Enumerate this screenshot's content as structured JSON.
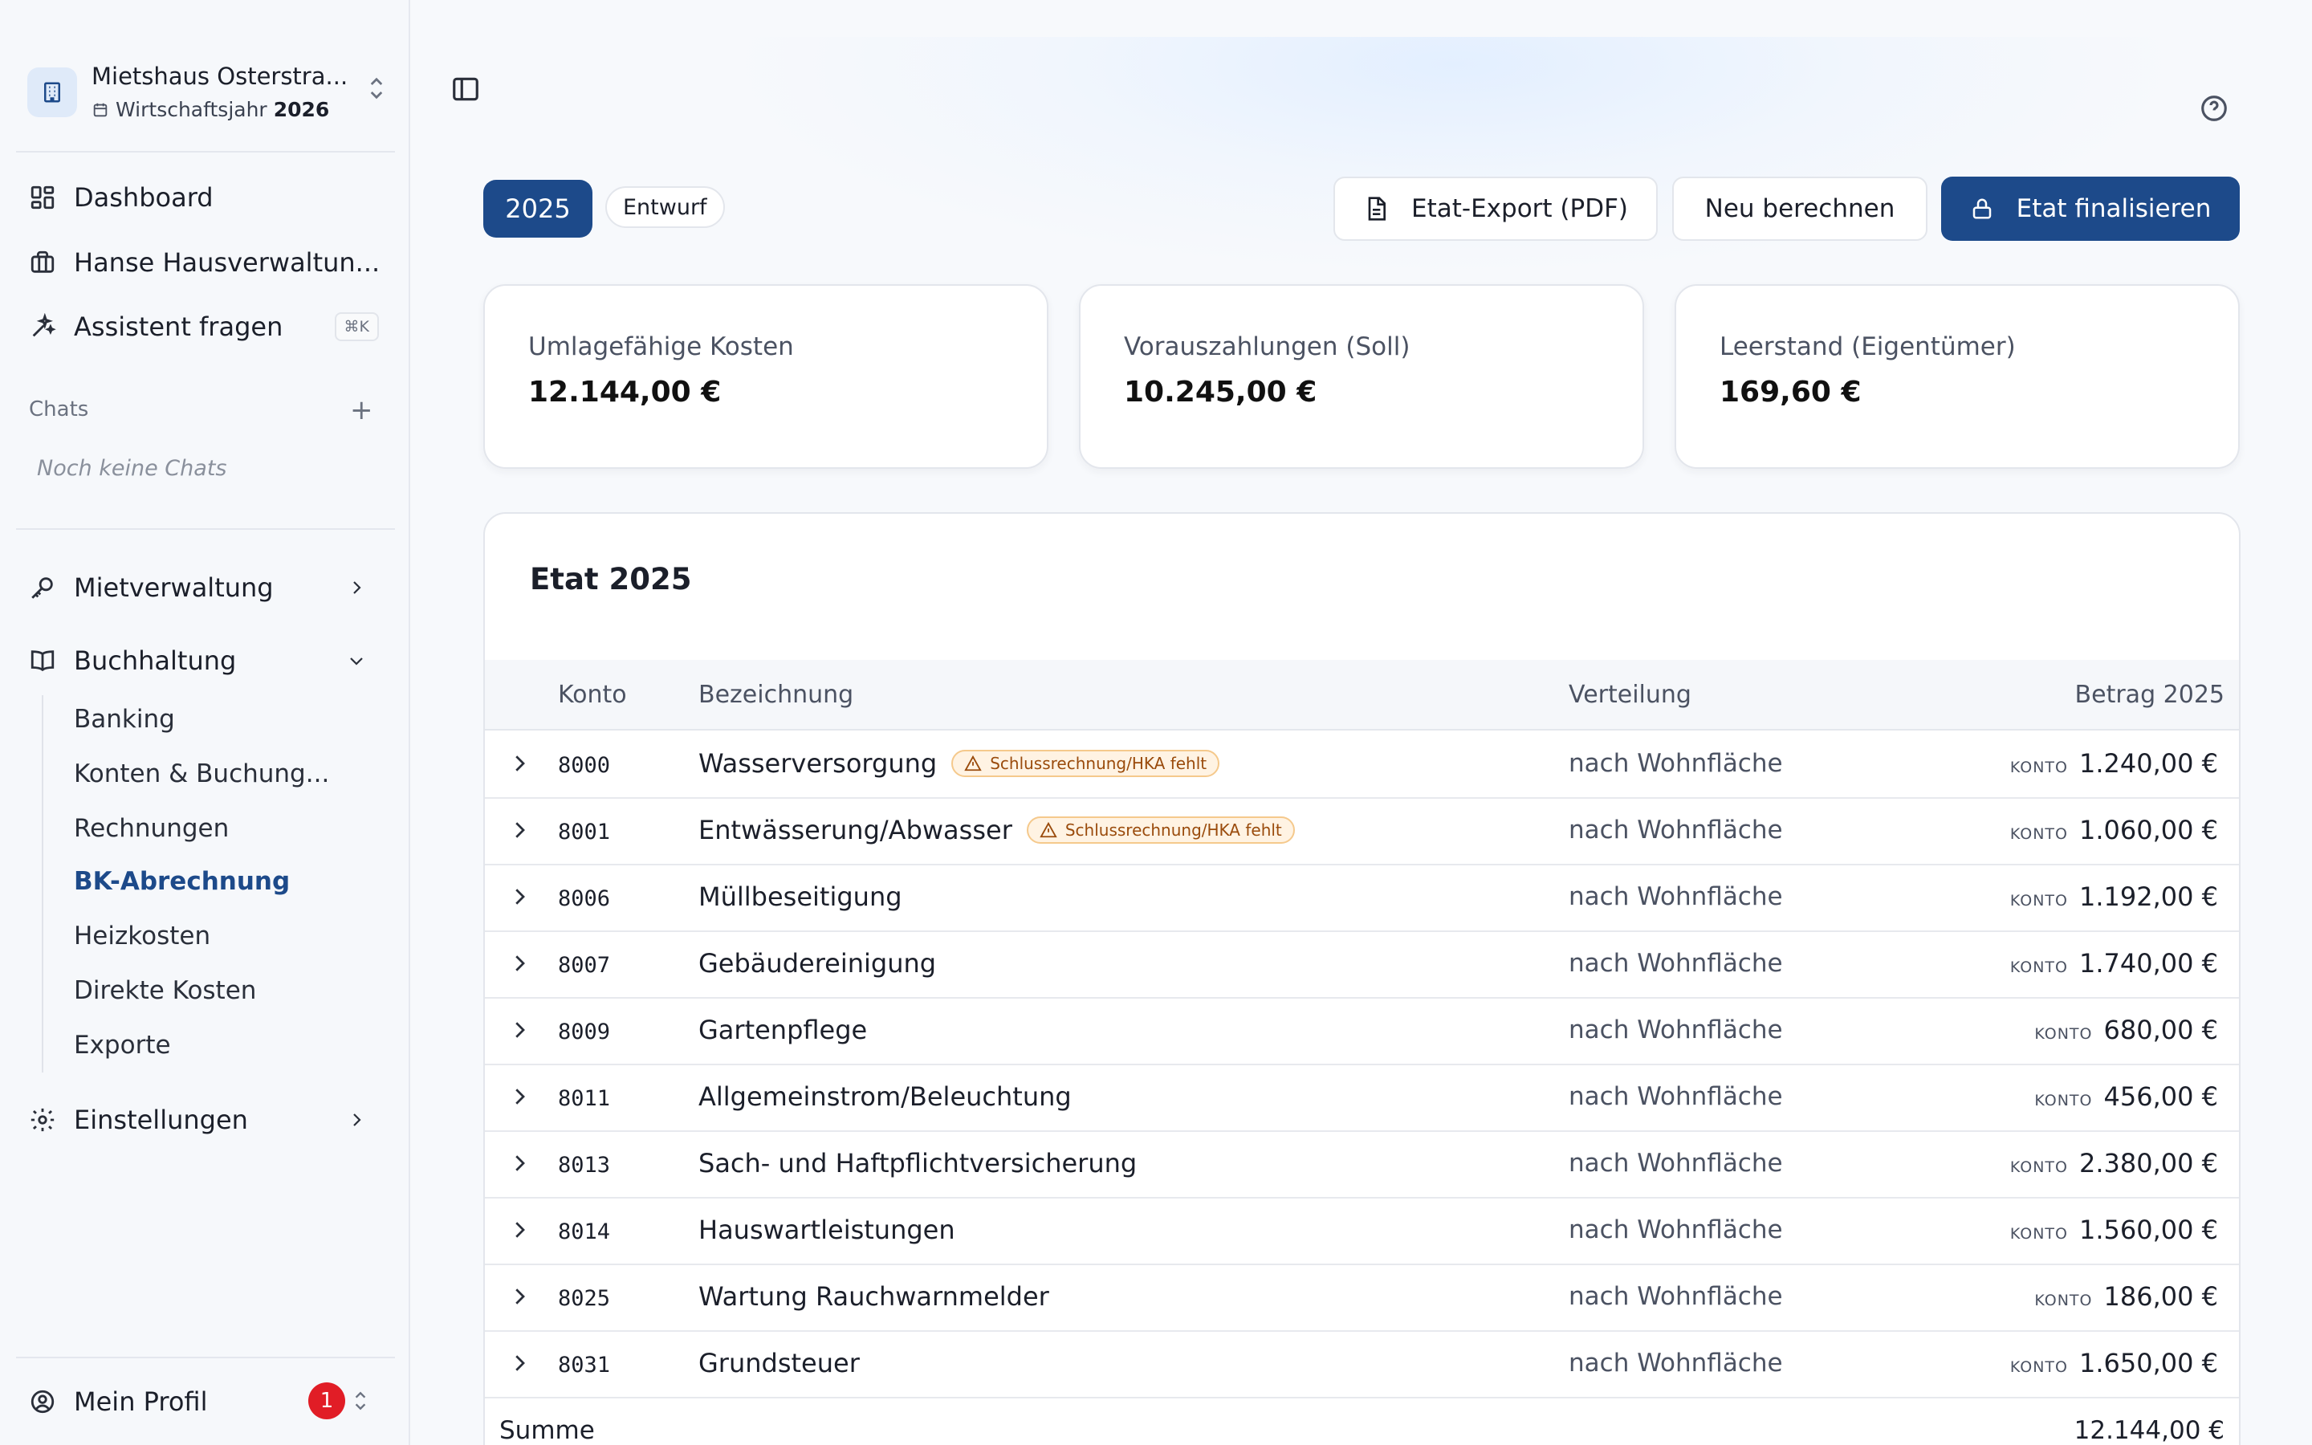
{
  "sidebar": {
    "property_name": "Mietshaus Osterstra...",
    "fiscal_year_label": "Wirtschaftsjahr",
    "fiscal_year": "2026",
    "nav": [
      {
        "label": "Dashboard",
        "icon": "dashboard-icon"
      },
      {
        "label": "Hanse Hausverwaltun...",
        "icon": "building-icon"
      },
      {
        "label": "Assistent fragen",
        "icon": "sparkles-icon",
        "shortcut": "⌘K"
      }
    ],
    "chats_label": "Chats",
    "chats_add": "+",
    "chats_empty": "Noch keine Chats",
    "sections": [
      {
        "label": "Mietverwaltung",
        "icon": "key-icon"
      },
      {
        "label": "Buchhaltung",
        "icon": "book-icon"
      }
    ],
    "buchhaltung_items": [
      "Banking",
      "Konten & Buchung...",
      "Rechnungen",
      "BK-Abrechnung",
      "Heizkosten",
      "Direkte Kosten",
      "Exporte"
    ],
    "active_item": "BK-Abrechnung",
    "settings_label": "Einstellungen",
    "profile_label": "Mein Profil",
    "profile_badge": "1"
  },
  "header": {
    "year": "2025",
    "status": "Entwurf",
    "export_btn": "Etat-Export (PDF)",
    "recalc_btn": "Neu berechnen",
    "finalize_btn": "Etat finalisieren"
  },
  "kpis": [
    {
      "label": "Umlagefähige Kosten",
      "value": "12.144,00 €"
    },
    {
      "label": "Vorauszahlungen (Soll)",
      "value": "10.245,00 €"
    },
    {
      "label": "Leerstand (Eigentümer)",
      "value": "169,60 €"
    }
  ],
  "table": {
    "title": "Etat 2025",
    "columns": [
      "Konto",
      "Bezeichnung",
      "Verteilung",
      "Betrag 2025"
    ],
    "source_tag": "KONTO",
    "warning_text": "Schlussrechnung/HKA fehlt",
    "rows": [
      {
        "konto": "8000",
        "bez": "Wasserversorgung",
        "vert": "nach Wohnfläche",
        "betrag": "1.240,00 €",
        "warning": true
      },
      {
        "konto": "8001",
        "bez": "Entwässerung/Abwasser",
        "vert": "nach Wohnfläche",
        "betrag": "1.060,00 €",
        "warning": true
      },
      {
        "konto": "8006",
        "bez": "Müllbeseitigung",
        "vert": "nach Wohnfläche",
        "betrag": "1.192,00 €",
        "warning": false
      },
      {
        "konto": "8007",
        "bez": "Gebäudereinigung",
        "vert": "nach Wohnfläche",
        "betrag": "1.740,00 €",
        "warning": false
      },
      {
        "konto": "8009",
        "bez": "Gartenpflege",
        "vert": "nach Wohnfläche",
        "betrag": "680,00 €",
        "warning": false
      },
      {
        "konto": "8011",
        "bez": "Allgemeinstrom/Beleuchtung",
        "vert": "nach Wohnfläche",
        "betrag": "456,00 €",
        "warning": false
      },
      {
        "konto": "8013",
        "bez": "Sach- und Haftpflichtversicherung",
        "vert": "nach Wohnfläche",
        "betrag": "2.380,00 €",
        "warning": false
      },
      {
        "konto": "8014",
        "bez": "Hauswartleistungen",
        "vert": "nach Wohnfläche",
        "betrag": "1.560,00 €",
        "warning": false
      },
      {
        "konto": "8025",
        "bez": "Wartung Rauchwarnmelder",
        "vert": "nach Wohnfläche",
        "betrag": "186,00 €",
        "warning": false
      },
      {
        "konto": "8031",
        "bez": "Grundsteuer",
        "vert": "nach Wohnfläche",
        "betrag": "1.650,00 €",
        "warning": false
      }
    ],
    "sum_label": "Summe",
    "sum_value": "12.144,00 €"
  }
}
